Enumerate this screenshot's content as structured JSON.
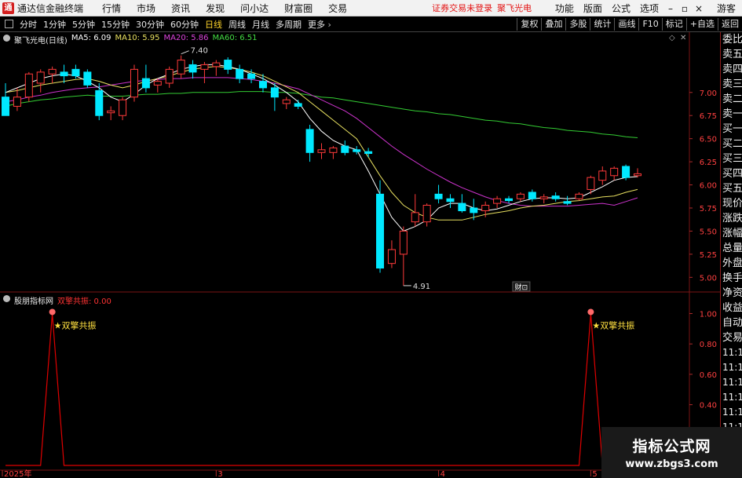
{
  "menubar": {
    "app_title": "通达信金融终端",
    "items": [
      "行情",
      "市场",
      "资讯",
      "发现",
      "问小达",
      "财富圈",
      "交易"
    ],
    "login_warning": "证券交易未登录",
    "stock_title": "聚飞光电",
    "right_items": [
      "功能",
      "版面",
      "公式",
      "选项"
    ],
    "guest": "游客",
    "logo_glyph": "通"
  },
  "toolbar": {
    "periods": [
      "分时",
      "1分钟",
      "5分钟",
      "15分钟",
      "30分钟",
      "60分钟",
      "日线",
      "周线",
      "月线",
      "多周期",
      "更多"
    ],
    "active_period": "日线",
    "right_buttons": [
      "复权",
      "叠加",
      "多股",
      "统计",
      "画线",
      "F10",
      "标记",
      "+自选",
      "返回"
    ]
  },
  "main_legend": {
    "stock": "聚飞光电(日线)",
    "ma5": "MA5: 6.09",
    "ma10": "MA10: 5.95",
    "ma20": "MA20: 5.86",
    "ma60": "MA60: 6.51"
  },
  "sub_legend": {
    "name": "股朋指标网",
    "value": "双擎共振: 0.00"
  },
  "annotations": {
    "high_label": "7.40",
    "low_label": "4.91",
    "signal_label": "★双擎共振",
    "finance_marker": "财"
  },
  "side_panel": {
    "header": "委比",
    "items": [
      "委比",
      "卖五",
      "卖四",
      "卖三",
      "卖二",
      "卖一",
      "买一",
      "买二",
      "买三",
      "买四",
      "买五",
      "现价",
      "涨跌",
      "涨幅",
      "总量",
      "外盘",
      "换手",
      "净资",
      "收益",
      "自动",
      "交易",
      "11:13",
      "11:13",
      "11:13",
      "11:13",
      "11:13",
      "11:13",
      "11:13",
      "11:13",
      "11:13"
    ]
  },
  "watermark": {
    "title": "指标公式网",
    "url": "www.zbgs3.com"
  },
  "colors": {
    "up": "#ff3a3a",
    "down": "#00e8ff",
    "ma5": "#ffffff",
    "ma10": "#e8e060",
    "ma20": "#cc33cc",
    "ma60": "#33cc33",
    "signal": "#e00000",
    "grid": "#7a1515"
  },
  "chart_data": {
    "type": "candlestick",
    "title": "聚飞光电(日线)",
    "price_axis": [
      7.0,
      6.75,
      6.5,
      6.25,
      6.0,
      5.75,
      5.5,
      5.25,
      5.0
    ],
    "price_range": [
      4.85,
      7.55
    ],
    "date_labels": [
      "2025年",
      "3",
      "4",
      "5"
    ],
    "candles": [
      {
        "o": 6.95,
        "h": 7.1,
        "l": 6.8,
        "c": 6.75
      },
      {
        "o": 6.85,
        "h": 7.05,
        "l": 6.8,
        "c": 6.95
      },
      {
        "o": 6.95,
        "h": 7.22,
        "l": 6.9,
        "c": 7.2
      },
      {
        "o": 7.1,
        "h": 7.25,
        "l": 7.0,
        "c": 7.22
      },
      {
        "o": 7.2,
        "h": 7.28,
        "l": 7.1,
        "c": 7.25
      },
      {
        "o": 7.22,
        "h": 7.3,
        "l": 7.1,
        "c": 7.18
      },
      {
        "o": 7.25,
        "h": 7.3,
        "l": 7.15,
        "c": 7.18
      },
      {
        "o": 7.22,
        "h": 7.25,
        "l": 7.05,
        "c": 7.08
      },
      {
        "o": 7.02,
        "h": 7.1,
        "l": 6.7,
        "c": 6.75
      },
      {
        "o": 6.78,
        "h": 6.85,
        "l": 6.7,
        "c": 6.8
      },
      {
        "o": 6.75,
        "h": 6.95,
        "l": 6.7,
        "c": 6.92
      },
      {
        "o": 6.95,
        "h": 7.3,
        "l": 6.9,
        "c": 7.25
      },
      {
        "o": 7.15,
        "h": 7.3,
        "l": 7.0,
        "c": 7.05
      },
      {
        "o": 7.08,
        "h": 7.15,
        "l": 7.0,
        "c": 7.12
      },
      {
        "o": 7.1,
        "h": 7.28,
        "l": 7.05,
        "c": 7.25
      },
      {
        "o": 7.2,
        "h": 7.4,
        "l": 7.15,
        "c": 7.35
      },
      {
        "o": 7.3,
        "h": 7.35,
        "l": 7.15,
        "c": 7.22
      },
      {
        "o": 7.25,
        "h": 7.33,
        "l": 7.1,
        "c": 7.3
      },
      {
        "o": 7.28,
        "h": 7.35,
        "l": 7.18,
        "c": 7.32
      },
      {
        "o": 7.35,
        "h": 7.38,
        "l": 7.2,
        "c": 7.25
      },
      {
        "o": 7.25,
        "h": 7.3,
        "l": 7.1,
        "c": 7.15
      },
      {
        "o": 7.2,
        "h": 7.25,
        "l": 7.1,
        "c": 7.15
      },
      {
        "o": 7.12,
        "h": 7.2,
        "l": 7.0,
        "c": 7.05
      },
      {
        "o": 7.05,
        "h": 7.1,
        "l": 6.8,
        "c": 6.95
      },
      {
        "o": 6.88,
        "h": 6.95,
        "l": 6.82,
        "c": 6.92
      },
      {
        "o": 6.88,
        "h": 6.92,
        "l": 6.82,
        "c": 6.85
      },
      {
        "o": 6.6,
        "h": 6.65,
        "l": 6.25,
        "c": 6.35
      },
      {
        "o": 6.35,
        "h": 6.45,
        "l": 6.28,
        "c": 6.38
      },
      {
        "o": 6.35,
        "h": 6.42,
        "l": 6.28,
        "c": 6.4
      },
      {
        "o": 6.42,
        "h": 6.48,
        "l": 6.32,
        "c": 6.35
      },
      {
        "o": 6.38,
        "h": 6.42,
        "l": 6.33,
        "c": 6.36
      },
      {
        "o": 6.36,
        "h": 6.4,
        "l": 6.3,
        "c": 6.34
      },
      {
        "o": 5.9,
        "h": 6.05,
        "l": 5.05,
        "c": 5.1
      },
      {
        "o": 5.15,
        "h": 5.4,
        "l": 5.1,
        "c": 5.3
      },
      {
        "o": 5.25,
        "h": 5.55,
        "l": 4.91,
        "c": 5.5
      },
      {
        "o": 5.6,
        "h": 5.9,
        "l": 5.55,
        "c": 5.7
      },
      {
        "o": 5.6,
        "h": 5.8,
        "l": 5.55,
        "c": 5.78
      },
      {
        "o": 5.9,
        "h": 6.0,
        "l": 5.8,
        "c": 5.85
      },
      {
        "o": 5.85,
        "h": 5.9,
        "l": 5.75,
        "c": 5.82
      },
      {
        "o": 5.8,
        "h": 5.9,
        "l": 5.7,
        "c": 5.72
      },
      {
        "o": 5.75,
        "h": 5.85,
        "l": 5.62,
        "c": 5.7
      },
      {
        "o": 5.72,
        "h": 5.82,
        "l": 5.65,
        "c": 5.78
      },
      {
        "o": 5.8,
        "h": 5.88,
        "l": 5.75,
        "c": 5.85
      },
      {
        "o": 5.85,
        "h": 5.88,
        "l": 5.8,
        "c": 5.83
      },
      {
        "o": 5.85,
        "h": 5.92,
        "l": 5.82,
        "c": 5.9
      },
      {
        "o": 5.92,
        "h": 5.95,
        "l": 5.82,
        "c": 5.85
      },
      {
        "o": 5.85,
        "h": 5.9,
        "l": 5.8,
        "c": 5.87
      },
      {
        "o": 5.88,
        "h": 5.92,
        "l": 5.82,
        "c": 5.85
      },
      {
        "o": 5.82,
        "h": 5.88,
        "l": 5.78,
        "c": 5.8
      },
      {
        "o": 5.85,
        "h": 5.92,
        "l": 5.83,
        "c": 5.9
      },
      {
        "o": 5.95,
        "h": 6.1,
        "l": 5.9,
        "c": 6.08
      },
      {
        "o": 6.05,
        "h": 6.2,
        "l": 6.0,
        "c": 6.15
      },
      {
        "o": 6.1,
        "h": 6.2,
        "l": 6.05,
        "c": 6.18
      },
      {
        "o": 6.2,
        "h": 6.22,
        "l": 6.05,
        "c": 6.08
      },
      {
        "o": 6.1,
        "h": 6.18,
        "l": 6.08,
        "c": 6.12
      }
    ],
    "ma60": [
      6.85,
      6.88,
      6.9,
      6.92,
      6.93,
      6.95,
      6.96,
      6.97,
      6.96,
      6.96,
      6.96,
      6.97,
      6.98,
      6.98,
      6.99,
      6.99,
      7.0,
      7.0,
      7.0,
      7.0,
      7.01,
      7.01,
      7.01,
      7.0,
      7.0,
      6.99,
      6.97,
      6.95,
      6.94,
      6.92,
      6.9,
      6.88,
      6.86,
      6.84,
      6.82,
      6.8,
      6.79,
      6.77,
      6.76,
      6.74,
      6.72,
      6.7,
      6.69,
      6.67,
      6.66,
      6.64,
      6.62,
      6.61,
      6.59,
      6.58,
      6.57,
      6.55,
      6.54,
      6.52,
      6.51
    ],
    "ma20": [
      6.9,
      6.92,
      6.95,
      6.97,
      7.0,
      7.02,
      7.04,
      7.05,
      7.06,
      7.08,
      7.1,
      7.12,
      7.13,
      7.14,
      7.15,
      7.15,
      7.16,
      7.16,
      7.16,
      7.16,
      7.15,
      7.14,
      7.12,
      7.1,
      7.07,
      7.04,
      6.98,
      6.92,
      6.86,
      6.8,
      6.72,
      6.62,
      6.52,
      6.42,
      6.33,
      6.25,
      6.17,
      6.1,
      6.03,
      5.97,
      5.92,
      5.87,
      5.83,
      5.8,
      5.78,
      5.77,
      5.77,
      5.77,
      5.77,
      5.78,
      5.79,
      5.8,
      5.78,
      5.82,
      5.86
    ],
    "ma10": [
      7.0,
      7.02,
      7.05,
      7.08,
      7.1,
      7.12,
      7.14,
      7.15,
      7.12,
      7.08,
      7.05,
      7.08,
      7.12,
      7.15,
      7.18,
      7.22,
      7.25,
      7.27,
      7.28,
      7.27,
      7.25,
      7.22,
      7.18,
      7.12,
      7.06,
      7.0,
      6.9,
      6.8,
      6.7,
      6.6,
      6.5,
      6.3,
      6.1,
      5.92,
      5.78,
      5.7,
      5.65,
      5.62,
      5.62,
      5.62,
      5.65,
      5.68,
      5.7,
      5.72,
      5.75,
      5.77,
      5.78,
      5.8,
      5.82,
      5.83,
      5.85,
      5.87,
      5.88,
      5.92,
      5.95
    ],
    "ma5": [
      7.0,
      7.05,
      7.1,
      7.15,
      7.18,
      7.2,
      7.18,
      7.12,
      7.05,
      6.95,
      6.9,
      6.98,
      7.08,
      7.15,
      7.2,
      7.25,
      7.28,
      7.3,
      7.3,
      7.28,
      7.25,
      7.2,
      7.15,
      7.08,
      7.0,
      6.9,
      6.72,
      6.58,
      6.48,
      6.42,
      6.38,
      6.15,
      5.9,
      5.65,
      5.5,
      5.55,
      5.62,
      5.75,
      5.8,
      5.8,
      5.75,
      5.72,
      5.74,
      5.78,
      5.82,
      5.85,
      5.86,
      5.86,
      5.85,
      5.86,
      5.92,
      5.98,
      6.05,
      6.08,
      6.09
    ],
    "indicator": {
      "name": "双擎共振",
      "axis": [
        1.0,
        0.8,
        0.6,
        0.4
      ],
      "range": [
        0,
        1.08
      ],
      "signal_index": [
        4,
        50
      ]
    }
  }
}
